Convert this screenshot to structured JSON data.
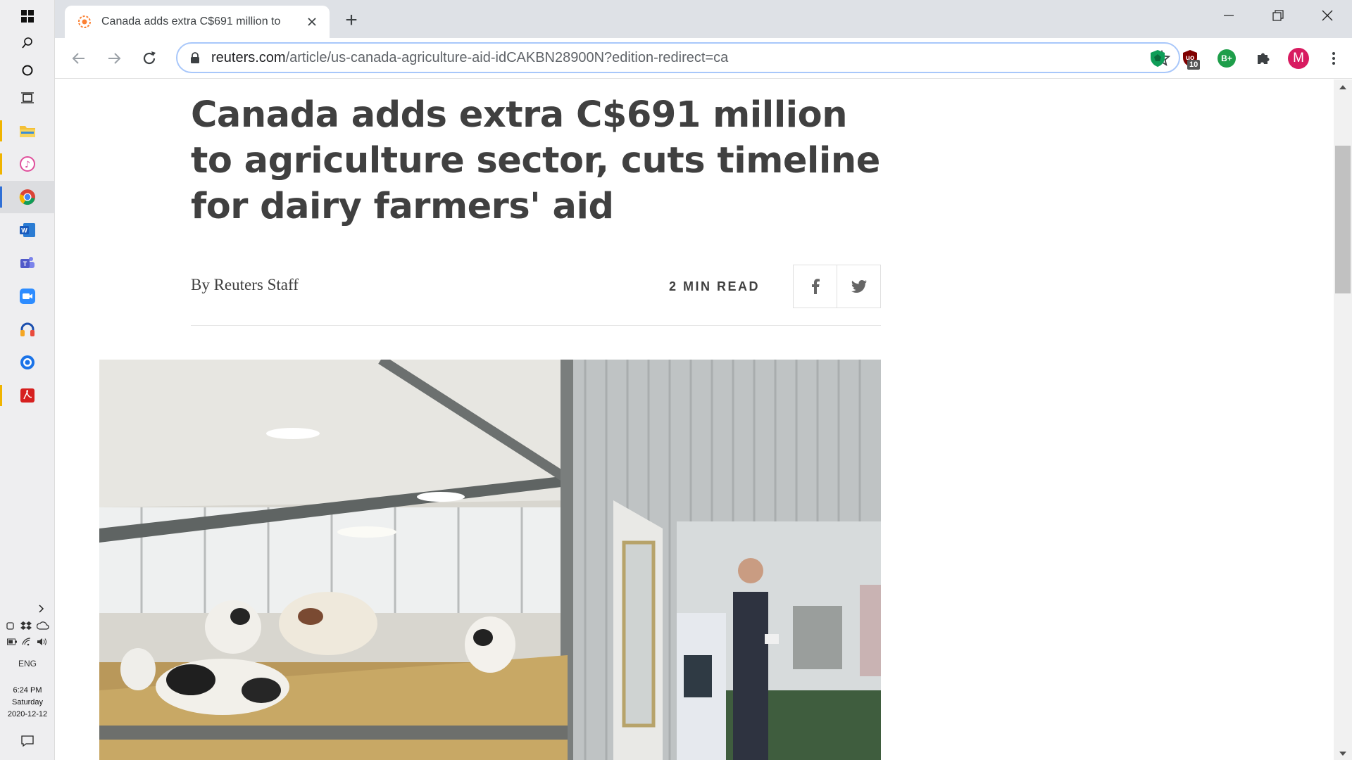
{
  "browser": {
    "tab_title": "Canada adds extra C$691 million to",
    "new_tab_symbol": "+",
    "url_domain": "reuters.com",
    "url_path": "/article/us-canada-agriculture-aid-idCAKBN28900N?edition-redirect=ca",
    "extension_badge": "10",
    "extension_grade": "B+",
    "profile_initial": "M"
  },
  "article": {
    "headline": "Canada adds extra C$691 million to agriculture sector, cuts timeline for dairy farmers' aid",
    "byline_prefix": "By",
    "author": "Reuters Staff",
    "read_time": "2 MIN READ"
  },
  "taskbar": {
    "language": "ENG",
    "time": "6:24 PM",
    "day": "Saturday",
    "date": "2020-12-12"
  },
  "colors": {
    "headline": "#404040",
    "tab_strip": "#dee1e6",
    "omnibox_focus": "#a8c7fa",
    "profile": "#d81b60",
    "grade_badge": "#1e9e4a"
  }
}
